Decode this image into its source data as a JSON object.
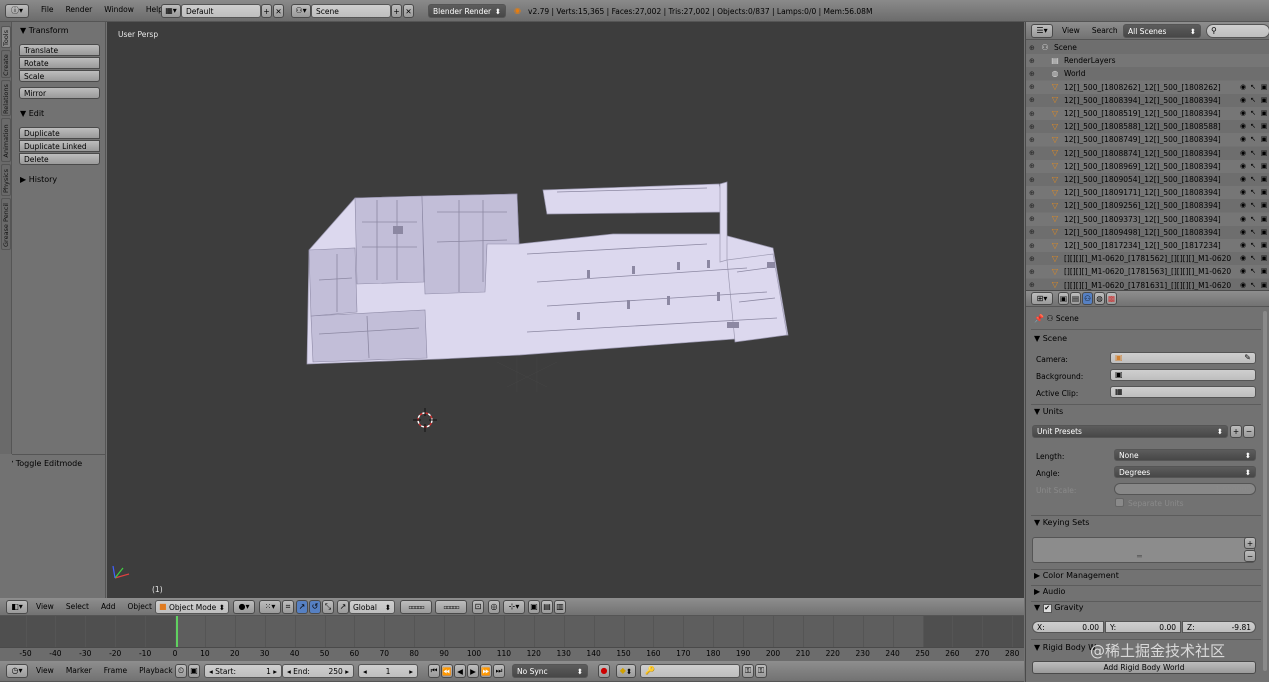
{
  "top_header": {
    "menus": [
      "File",
      "Render",
      "Window",
      "Help"
    ],
    "screen_layout": "Default",
    "scene": "Scene",
    "render_engine": "Blender Render",
    "stats": "v2.79 | Verts:15,365 | Faces:27,002 | Tris:27,002 | Objects:0/837 | Lamps:0/0 | Mem:56.08M"
  },
  "tool_tabs": [
    "Tools",
    "Create",
    "Relations",
    "Animation",
    "Physics",
    "Grease Pencil"
  ],
  "tool_shelf": {
    "transform_title": "Transform",
    "transform_buttons": [
      "Translate",
      "Rotate",
      "Scale"
    ],
    "mirror": "Mirror",
    "edit_title": "Edit",
    "edit_buttons": [
      "Duplicate",
      "Duplicate Linked",
      "Delete"
    ],
    "history_title": "History",
    "toggle_editmode": "Toggle Editmode"
  },
  "viewport": {
    "view_label": "User Persp",
    "frame_label": "(1)"
  },
  "viewport_header": {
    "menus": [
      "View",
      "Select",
      "Add",
      "Object"
    ],
    "mode": "Object Mode",
    "orientation": "Global"
  },
  "outliner": {
    "menus": [
      "View",
      "Search"
    ],
    "display": "All Scenes",
    "items": [
      {
        "label": "Scene",
        "indent": 0,
        "icon": "scene-icon"
      },
      {
        "label": "RenderLayers",
        "indent": 1,
        "icon": "renderlayers-icon"
      },
      {
        "label": "World",
        "indent": 1,
        "icon": "world-icon"
      },
      {
        "label": "12[]_500_[1808262]_12[]_500_[1808262]",
        "indent": 1,
        "icon": "mesh-icon"
      },
      {
        "label": "12[]_500_[1808394]_12[]_500_[1808394]",
        "indent": 1,
        "icon": "mesh-icon"
      },
      {
        "label": "12[]_500_[1808519]_12[]_500_[1808394]",
        "indent": 1,
        "icon": "mesh-icon"
      },
      {
        "label": "12[]_500_[1808588]_12[]_500_[1808588]",
        "indent": 1,
        "icon": "mesh-icon"
      },
      {
        "label": "12[]_500_[1808749]_12[]_500_[1808394]",
        "indent": 1,
        "icon": "mesh-icon"
      },
      {
        "label": "12[]_500_[1808874]_12[]_500_[1808394]",
        "indent": 1,
        "icon": "mesh-icon"
      },
      {
        "label": "12[]_500_[1808969]_12[]_500_[1808394]",
        "indent": 1,
        "icon": "mesh-icon"
      },
      {
        "label": "12[]_500_[1809054]_12[]_500_[1808394]",
        "indent": 1,
        "icon": "mesh-icon"
      },
      {
        "label": "12[]_500_[1809171]_12[]_500_[1808394]",
        "indent": 1,
        "icon": "mesh-icon"
      },
      {
        "label": "12[]_500_[1809256]_12[]_500_[1808394]",
        "indent": 1,
        "icon": "mesh-icon"
      },
      {
        "label": "12[]_500_[1809373]_12[]_500_[1808394]",
        "indent": 1,
        "icon": "mesh-icon"
      },
      {
        "label": "12[]_500_[1809498]_12[]_500_[1808394]",
        "indent": 1,
        "icon": "mesh-icon"
      },
      {
        "label": "12[]_500_[1817234]_12[]_500_[1817234]",
        "indent": 1,
        "icon": "mesh-icon"
      },
      {
        "label": "[][][][]_M1-0620_[1781562]_[][][][]_M1-0620",
        "indent": 1,
        "icon": "mesh-icon"
      },
      {
        "label": "[][][][]_M1-0620_[1781563]_[][][][]_M1-0620",
        "indent": 1,
        "icon": "mesh-icon"
      },
      {
        "label": "[][][][]_M1-0620_[1781631]_[][][][]_M1-0620",
        "indent": 1,
        "icon": "mesh-icon"
      }
    ]
  },
  "properties": {
    "context": "Scene",
    "scene_panel": "Scene",
    "camera_label": "Camera:",
    "background_label": "Background:",
    "active_clip_label": "Active Clip:",
    "units_panel": "Units",
    "unit_presets": "Unit Presets",
    "length_label": "Length:",
    "length_value": "None",
    "angle_label": "Angle:",
    "angle_value": "Degrees",
    "unit_scale_label": "Unit Scale:",
    "unit_scale_value": "1.000000",
    "separate_units": "Separate Units",
    "keying_sets_panel": "Keying Sets",
    "color_management": "Color Management",
    "audio": "Audio",
    "gravity": "Gravity",
    "gravity_x_label": "X:",
    "gravity_x": "0.00",
    "gravity_y_label": "Y:",
    "gravity_y": "0.00",
    "gravity_z_label": "Z:",
    "gravity_z": "-9.81",
    "rigid_body": "Rigid Body W",
    "add_rigid_body": "Add Rigid Body World"
  },
  "timeline": {
    "ticks": [
      "-50",
      "-40",
      "-30",
      "-20",
      "-10",
      "0",
      "10",
      "20",
      "30",
      "40",
      "50",
      "60",
      "70",
      "80",
      "90",
      "100",
      "110",
      "120",
      "130",
      "140",
      "150",
      "160",
      "170",
      "180",
      "190",
      "200",
      "210",
      "220",
      "230",
      "240",
      "250",
      "260",
      "270",
      "280"
    ],
    "menus": [
      "View",
      "Marker",
      "Frame",
      "Playback"
    ],
    "start_label": "Start:",
    "start": "1",
    "end_label": "End:",
    "end": "250",
    "current": "1",
    "sync": "No Sync"
  },
  "watermark": "@稀土掘金技术社区",
  "colors": {
    "viewport_bg": "#3d3d3d",
    "panel_bg": "#727272",
    "selected": "#5680c2",
    "active_frame": "#60d060"
  }
}
